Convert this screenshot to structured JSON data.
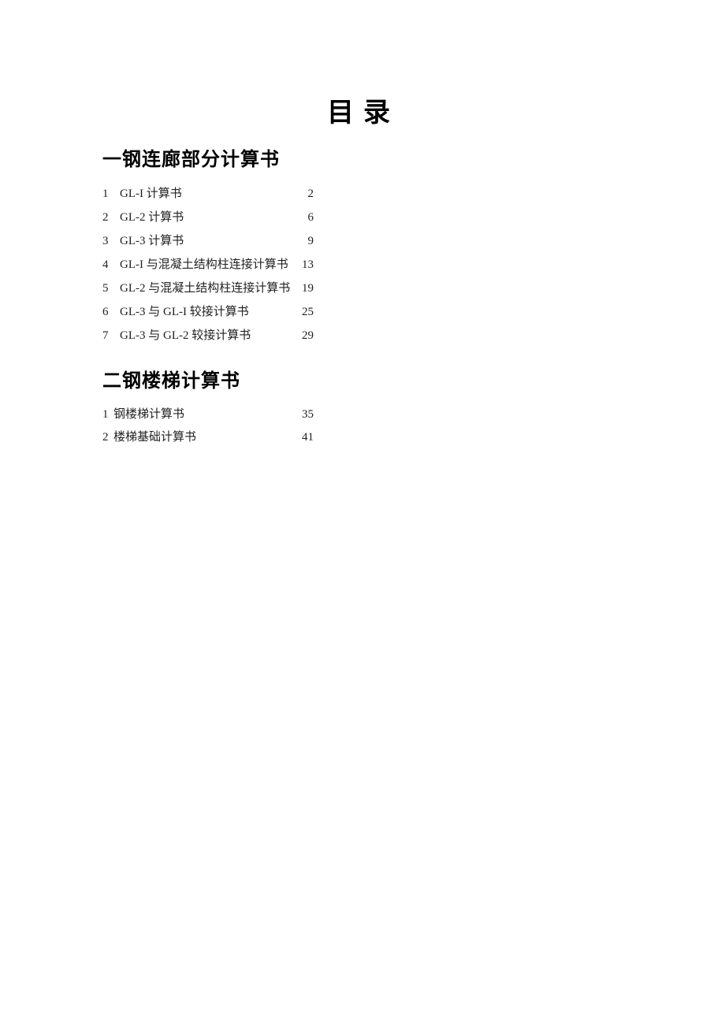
{
  "title": "目录",
  "section1": {
    "heading": "一钢连廊部分计算书",
    "items": [
      {
        "num": "1",
        "label": "GL-I 计算书",
        "page": "2"
      },
      {
        "num": "2",
        "label": "GL-2 计算书",
        "page": "6"
      },
      {
        "num": "3",
        "label": "GL-3 计算书",
        "page": "9"
      },
      {
        "num": "4",
        "label": "GL-I 与混凝土结构柱连接计算书",
        "page": "13"
      },
      {
        "num": "5",
        "label": "GL-2 与混凝土结构柱连接计算书",
        "page": "19"
      },
      {
        "num": "6",
        "label": "GL-3 与 GL-I 较接计算书",
        "page": "25"
      },
      {
        "num": "7",
        "label": "GL-3 与 GL-2 较接计算书",
        "page": "29"
      }
    ]
  },
  "section2": {
    "heading": "二钢楼梯计算书",
    "items": [
      {
        "num": "1",
        "label": "钢楼梯计算书",
        "page": "35"
      },
      {
        "num": "2",
        "label": "楼梯基础计算书",
        "page": "41"
      }
    ]
  }
}
